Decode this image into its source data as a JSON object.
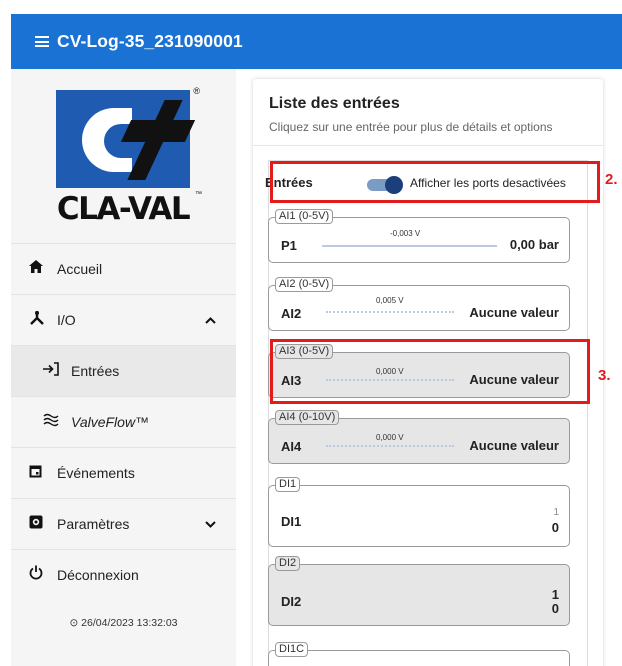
{
  "header": {
    "title": "CV-Log-35_231090001"
  },
  "logo": {
    "text": "CLA-VAL"
  },
  "sidebar": {
    "items": [
      {
        "label": "Accueil",
        "icon": "home-icon"
      },
      {
        "label": "I/O",
        "icon": "io-fork-icon"
      },
      {
        "label": "Entrées",
        "icon": "login-arrow-icon"
      },
      {
        "label": "ValveFlow™",
        "icon": "waves-icon"
      },
      {
        "label": "Événements",
        "icon": "calendar-icon"
      },
      {
        "label": "Paramètres",
        "icon": "settings-icon"
      },
      {
        "label": "Déconnexion",
        "icon": "power-icon"
      }
    ],
    "timestamp": "⊙ 26/04/2023 13:32:03"
  },
  "main": {
    "title": "Liste des entrées",
    "subtitle": "Cliquez sur une entrée pour plus de détails et options",
    "entries_label": "Entrées",
    "toggle_label": "Afficher les ports desactivées",
    "toggle_on": true,
    "inputs": [
      {
        "tag": "AI1 (0-5V)",
        "name": "P1",
        "voltage": "-0,003 V",
        "value": "0,00 bar",
        "disabled": false
      },
      {
        "tag": "AI2 (0-5V)",
        "name": "AI2",
        "voltage": "0,005 V",
        "value": "Aucune valeur",
        "disabled": false
      },
      {
        "tag": "AI3 (0-5V)",
        "name": "AI3",
        "voltage": "0,000 V",
        "value": "Aucune valeur",
        "disabled": true
      },
      {
        "tag": "AI4 (0-10V)",
        "name": "AI4",
        "voltage": "0,000 V",
        "value": "Aucune valeur",
        "disabled": true
      },
      {
        "tag": "DI1",
        "name": "DI1",
        "top": "1",
        "bottom": "0",
        "disabled": false
      },
      {
        "tag": "DI2",
        "name": "DI2",
        "top": "1",
        "bottom": "0",
        "disabled": true
      },
      {
        "tag": "DI1C",
        "name": "",
        "disabled": false
      }
    ]
  },
  "annotations": {
    "a2": "2.",
    "a3": "3."
  },
  "colors": {
    "topbar": "#1a73d4",
    "annotation": "#e31b1b",
    "brand_blue": "#1f5bb0"
  }
}
